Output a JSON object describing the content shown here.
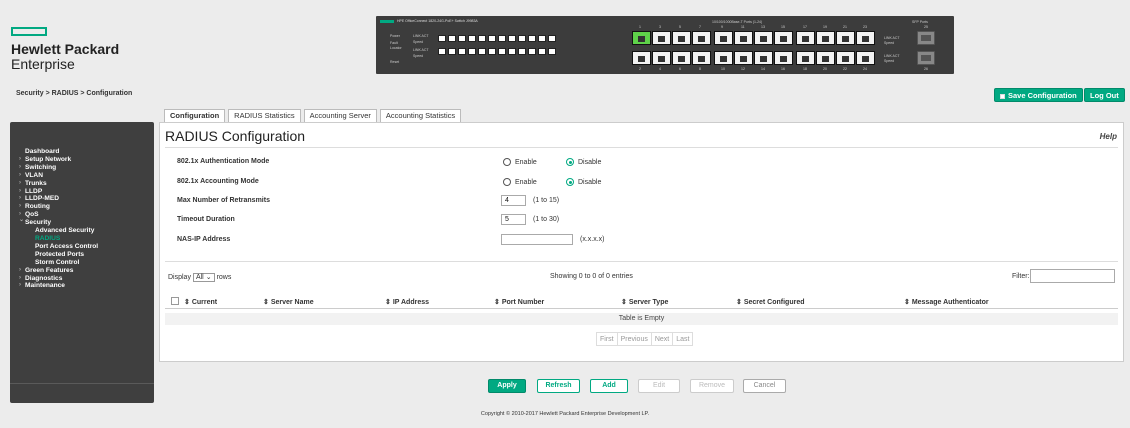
{
  "logo": {
    "line1": "Hewlett Packard",
    "line2": "Enterprise"
  },
  "switch": {
    "title": "HPE OfficeConnect 1820-24G-PoE+ Switch J9983A",
    "mid_title": "10/100/1000Base-T Ports (1-24)",
    "sfp_title": "SFP Ports",
    "led_labels": [
      "Power",
      "Fault",
      "Locator",
      "Reset",
      "LINK ACT",
      "Speed",
      "LINK ACT",
      "Speed"
    ],
    "top_numbers": [
      "1",
      "3",
      "5",
      "7",
      "9",
      "11",
      "13",
      "15",
      "17",
      "19",
      "21",
      "23",
      "25"
    ],
    "bottom_numbers": [
      "2",
      "4",
      "6",
      "8",
      "10",
      "12",
      "14",
      "16",
      "18",
      "20",
      "22",
      "24",
      "26"
    ]
  },
  "breadcrumb": "Security > RADIUS > Configuration",
  "header_buttons": {
    "save": "Save Configuration",
    "logout": "Log Out"
  },
  "tabs": [
    {
      "label": "Configuration",
      "active": true
    },
    {
      "label": "RADIUS Statistics",
      "active": false
    },
    {
      "label": "Accounting Server",
      "active": false
    },
    {
      "label": "Accounting Statistics",
      "active": false
    }
  ],
  "sidebar": {
    "items": [
      {
        "label": "Dashboard",
        "type": "plain"
      },
      {
        "label": "Setup Network",
        "type": "arrow"
      },
      {
        "label": "Switching",
        "type": "arrow"
      },
      {
        "label": "VLAN",
        "type": "arrow"
      },
      {
        "label": "Trunks",
        "type": "arrow"
      },
      {
        "label": "LLDP",
        "type": "arrow"
      },
      {
        "label": "LLDP-MED",
        "type": "arrow"
      },
      {
        "label": "Routing",
        "type": "arrow"
      },
      {
        "label": "QoS",
        "type": "arrow"
      },
      {
        "label": "Security",
        "type": "open"
      },
      {
        "label": "Advanced Security",
        "type": "sub"
      },
      {
        "label": "RADIUS",
        "type": "sub-current"
      },
      {
        "label": "Port Access Control",
        "type": "sub"
      },
      {
        "label": "Protected Ports",
        "type": "sub"
      },
      {
        "label": "Storm Control",
        "type": "sub"
      },
      {
        "label": "Green Features",
        "type": "arrow"
      },
      {
        "label": "Diagnostics",
        "type": "arrow"
      },
      {
        "label": "Maintenance",
        "type": "arrow"
      }
    ]
  },
  "panel": {
    "title": "RADIUS Configuration",
    "help": "Help",
    "fields": {
      "auth_mode": {
        "label": "802.1x Authentication Mode",
        "enable": "Enable",
        "disable": "Disable",
        "selected": "Disable"
      },
      "acct_mode": {
        "label": "802.1x Accounting Mode",
        "enable": "Enable",
        "disable": "Disable",
        "selected": "Disable"
      },
      "retransmits": {
        "label": "Max Number of Retransmits",
        "value": "4",
        "hint": "(1 to 15)"
      },
      "timeout": {
        "label": "Timeout Duration",
        "value": "5",
        "hint": "(1 to 30)"
      },
      "nas_ip": {
        "label": "NAS-IP Address",
        "value": "",
        "hint": "(x.x.x.x)"
      }
    },
    "table_controls": {
      "display": "Display",
      "display_value": "All",
      "rows": "rows",
      "showing": "Showing 0 to 0 of 0 entries",
      "filter": "Filter:"
    },
    "table": {
      "columns": [
        "Current",
        "Server Name",
        "IP Address",
        "Port Number",
        "Server Type",
        "Secret Configured",
        "Message Authenticator"
      ],
      "empty": "Table is Empty"
    },
    "pager": [
      "First",
      "Previous",
      "Next",
      "Last"
    ]
  },
  "action_buttons": {
    "apply": "Apply",
    "refresh": "Refresh",
    "add": "Add",
    "edit": "Edit",
    "remove": "Remove",
    "cancel": "Cancel"
  },
  "copyright": "Copyright © 2010-2017 Hewlett Packard Enterprise Development LP."
}
